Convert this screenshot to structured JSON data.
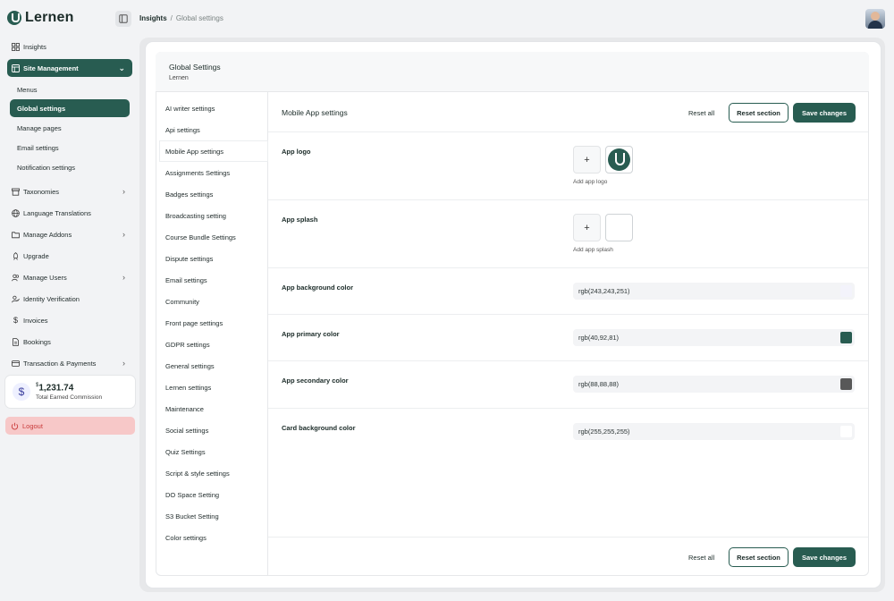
{
  "app": {
    "name": "Lernen"
  },
  "breadcrumb": {
    "current": "Insights",
    "separator": "/",
    "last": "Global settings"
  },
  "sidebar": {
    "items": [
      {
        "label": "Insights",
        "icon": "grid-icon"
      },
      {
        "label": "Site Management",
        "icon": "layout-icon",
        "expanded": true
      },
      {
        "label": "Taxonomies",
        "icon": "archive-icon"
      },
      {
        "label": "Language Translations",
        "icon": "globe-icon"
      },
      {
        "label": "Manage Addons",
        "icon": "folder-icon"
      },
      {
        "label": "Upgrade",
        "icon": "rocket-icon"
      },
      {
        "label": "Manage Users",
        "icon": "users-icon"
      },
      {
        "label": "Identity Verification",
        "icon": "user-check-icon"
      },
      {
        "label": "Invoices",
        "icon": "dollar-icon"
      },
      {
        "label": "Bookings",
        "icon": "document-icon"
      },
      {
        "label": "Transaction & Payments",
        "icon": "card-icon"
      }
    ],
    "sub_items": [
      "Menus",
      "Global settings",
      "Manage pages",
      "Email settings",
      "Notification settings"
    ],
    "commission": {
      "currency": "$",
      "amount": "1,231.74",
      "label": "Total Earned Commission"
    },
    "logout": "Logout"
  },
  "settings": {
    "title": "Global Settings",
    "subtitle": "Lernen",
    "nav": [
      "AI writer settings",
      "Api settings",
      "Mobile App settings",
      "Assignments Settings",
      "Badges settings",
      "Broadcasting setting",
      "Course Bundle Settings",
      "Dispute settings",
      "Email settings",
      "Community",
      "Front page settings",
      "GDPR settings",
      "General settings",
      "Lernen settings",
      "Maintenance",
      "Social settings",
      "Quiz Settings",
      "Script & style settings",
      "DO Space Setting",
      "S3 Bucket Setting",
      "Color settings"
    ],
    "active_nav": "Mobile App settings"
  },
  "section": {
    "title": "Mobile App settings",
    "reset_all": "Reset all",
    "reset_section": "Reset section",
    "save": "Save changes",
    "app_logo": {
      "label": "App logo",
      "caption": "Add app logo",
      "plus": "+"
    },
    "app_splash": {
      "label": "App splash",
      "caption": "Add app splash",
      "plus": "+"
    },
    "colors": [
      {
        "label": "App background color",
        "value": "rgb(243,243,251)",
        "swatch": "#f3f3fb"
      },
      {
        "label": "App primary color",
        "value": "rgb(40,92,81)",
        "swatch": "#285c51"
      },
      {
        "label": "App secondary color",
        "value": "rgb(88,88,88)",
        "swatch": "#585858"
      },
      {
        "label": "Card background color",
        "value": "rgb(255,255,255)",
        "swatch": "#ffffff"
      }
    ]
  }
}
